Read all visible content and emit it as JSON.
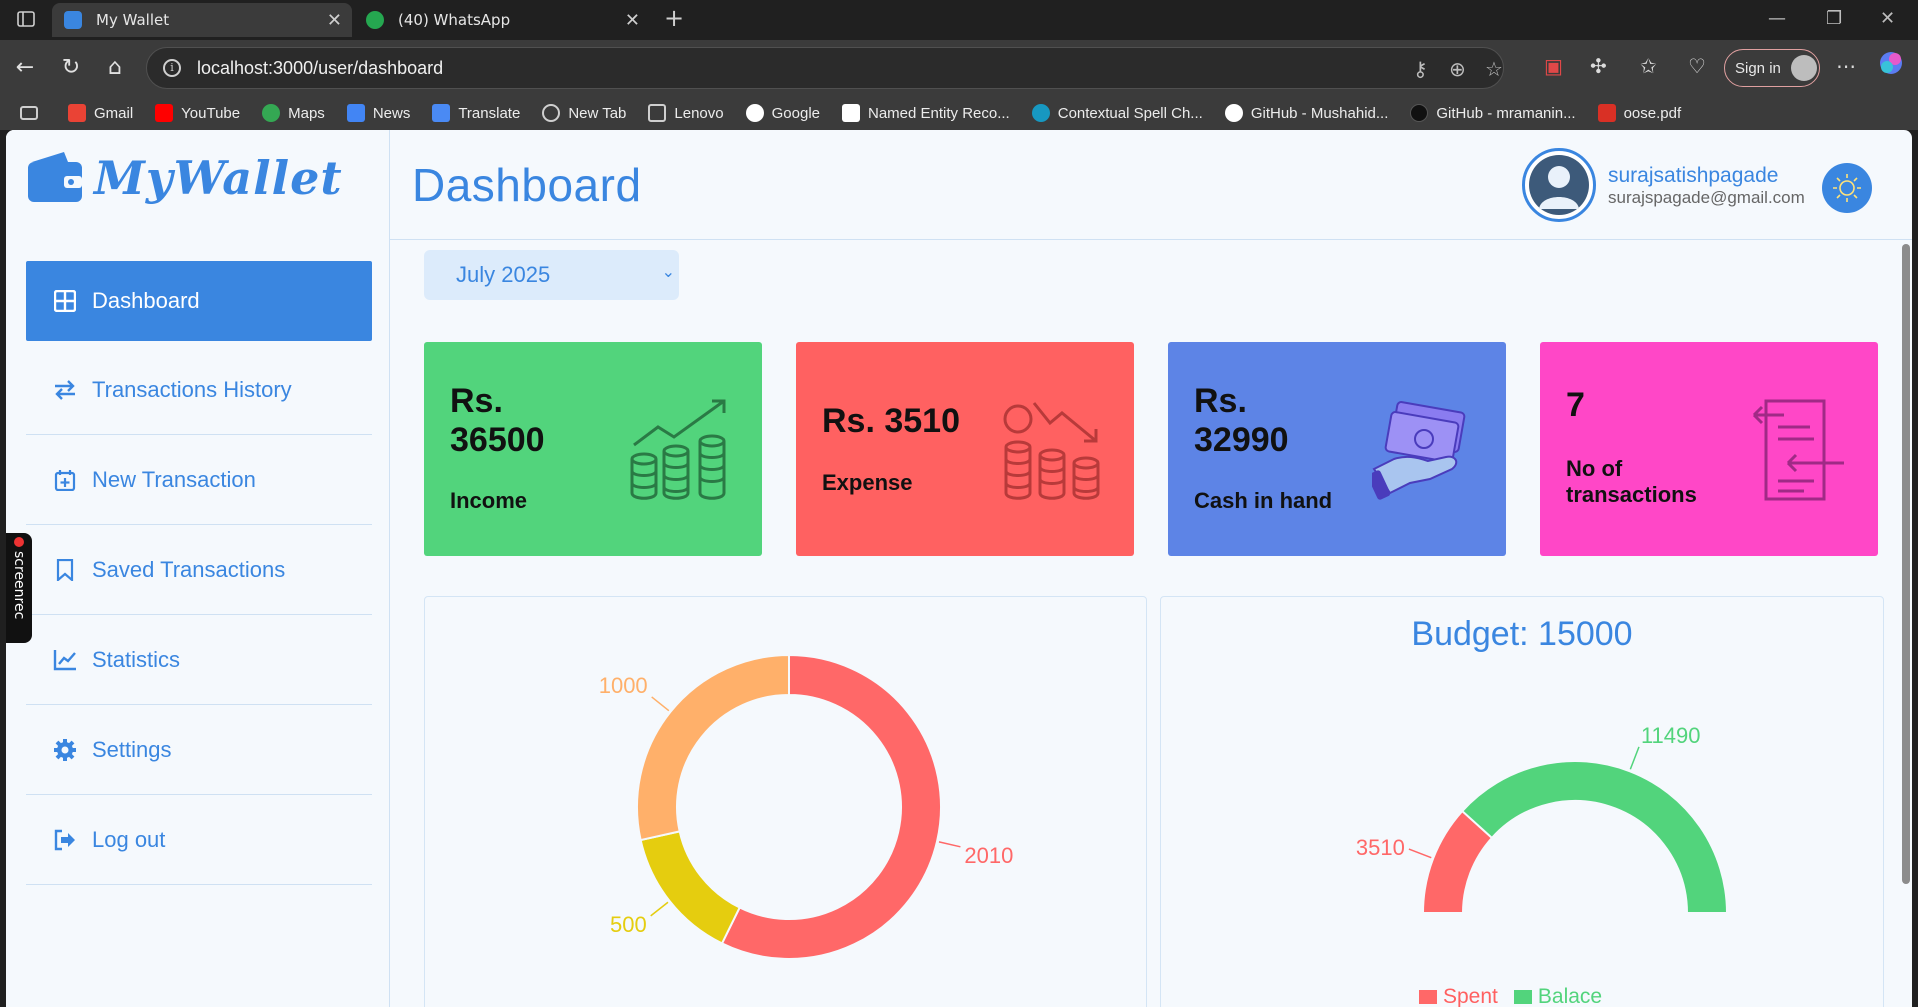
{
  "browser": {
    "tabs": [
      {
        "title": "My Wallet",
        "active": true
      },
      {
        "title": "(40) WhatsApp",
        "active": false
      }
    ],
    "url": "localhost:3000/user/dashboard",
    "signin_label": "Sign in",
    "bookmarks": [
      "Gmail",
      "YouTube",
      "Maps",
      "News",
      "Translate",
      "New Tab",
      "Lenovo",
      "Google",
      "Named Entity Reco...",
      "Contextual Spell Ch...",
      "GitHub - Mushahid...",
      "GitHub - mramanin...",
      "oose.pdf"
    ]
  },
  "app": {
    "logo_text": "MyWallet",
    "screenrec_label": "screenrec",
    "menu": [
      {
        "label": "Dashboard",
        "icon": "grid-icon",
        "active": true
      },
      {
        "label": "Transactions History",
        "icon": "arrows-swap-icon"
      },
      {
        "label": "New Transaction",
        "icon": "calendar-plus-icon"
      },
      {
        "label": "Saved Transactions",
        "icon": "bookmark-icon"
      },
      {
        "label": "Statistics",
        "icon": "line-chart-icon"
      },
      {
        "label": "Settings",
        "icon": "gear-icon"
      },
      {
        "label": "Log out",
        "icon": "logout-icon"
      }
    ]
  },
  "header": {
    "title": "Dashboard",
    "user_name": "surajsatishpagade",
    "user_email": "surajspagade@gmail.com"
  },
  "month_select": {
    "value": "July 2025"
  },
  "cards": [
    {
      "line1": "Rs.",
      "line2": "36500",
      "label": "Income",
      "color": "#52d47c",
      "icon": "coins-growth-icon"
    },
    {
      "line1": "Rs. 3510",
      "line2": "",
      "label": "Expense",
      "color": "#ff6161",
      "icon": "coins-decline-icon"
    },
    {
      "line1": "Rs.",
      "line2": "32990",
      "label": "Cash in hand",
      "color": "#5d84e6",
      "icon": "cash-hand-icon"
    },
    {
      "line1": "7",
      "line2": "",
      "label_line1": "No of",
      "label_line2": "transactions",
      "color": "#ff47c7",
      "icon": "transactions-doc-icon"
    }
  ],
  "budget_title": "Budget: 15000",
  "legend": {
    "spent": "Spent",
    "balance": "Balace"
  },
  "chart_data": [
    {
      "type": "pie",
      "donut": true,
      "slices": [
        {
          "value": 2010,
          "label": "2010",
          "color": "#ff6868"
        },
        {
          "value": 500,
          "label": "500",
          "color": "#e5cd0f"
        },
        {
          "value": 1000,
          "label": "1000",
          "color": "#ffb06a"
        }
      ]
    },
    {
      "type": "pie",
      "half_donut": true,
      "title": "Budget: 15000",
      "slices": [
        {
          "name": "Spent",
          "value": 3510,
          "label": "3510",
          "color": "#ff6868"
        },
        {
          "name": "Balace",
          "value": 11490,
          "label": "11490",
          "color": "#52d47c"
        }
      ]
    }
  ]
}
